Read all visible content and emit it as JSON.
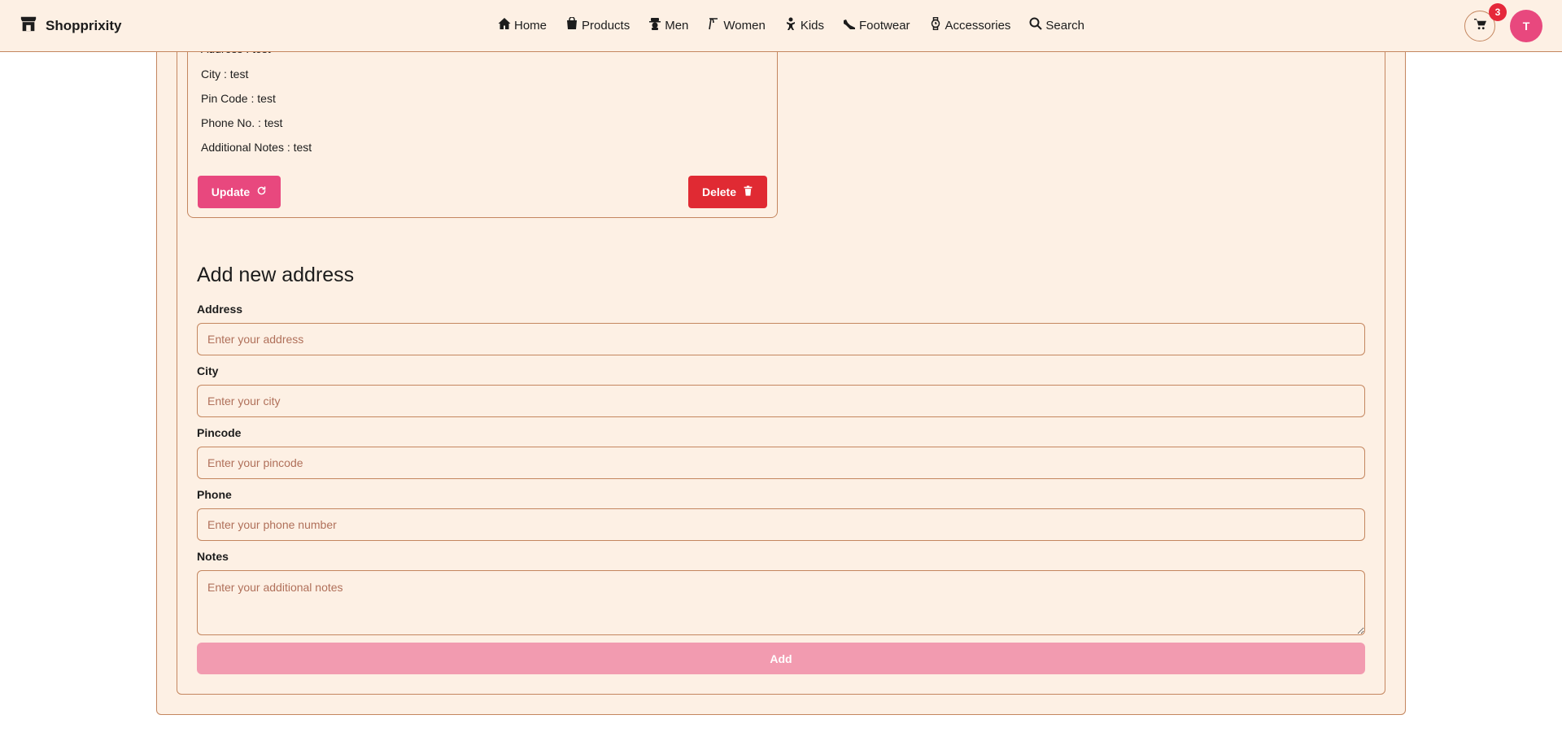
{
  "colors": {
    "background": "#fdf0e4",
    "border": "#c4865f",
    "accent_pink": "#e8487e",
    "danger_red": "#e02a33",
    "badge_red": "#e5283a",
    "disabled_pink": "#f29bb0"
  },
  "header": {
    "brand": "Shopprixity",
    "brand_icon": "store-icon",
    "nav": [
      {
        "label": "Home",
        "icon": "home-icon"
      },
      {
        "label": "Products",
        "icon": "shopping-bag-icon"
      },
      {
        "label": "Men",
        "icon": "man-icon"
      },
      {
        "label": "Women",
        "icon": "woman-icon"
      },
      {
        "label": "Kids",
        "icon": "child-icon"
      },
      {
        "label": "Footwear",
        "icon": "shoe-icon"
      },
      {
        "label": "Accessories",
        "icon": "watch-icon"
      },
      {
        "label": "Search",
        "icon": "search-icon"
      }
    ],
    "cart_count": "3",
    "avatar_initial": "T"
  },
  "address_card": {
    "partial_line": "Address : test",
    "lines": [
      "City : test",
      "Pin Code : test",
      "Phone No. : test",
      "Additional Notes : test"
    ],
    "update_label": "Update",
    "delete_label": "Delete"
  },
  "form": {
    "title": "Add new address",
    "fields": [
      {
        "label": "Address",
        "placeholder": "Enter your address"
      },
      {
        "label": "City",
        "placeholder": "Enter your city"
      },
      {
        "label": "Pincode",
        "placeholder": "Enter your pincode"
      },
      {
        "label": "Phone",
        "placeholder": "Enter your phone number"
      },
      {
        "label": "Notes",
        "placeholder": "Enter your additional notes"
      }
    ],
    "submit_label": "Add"
  }
}
